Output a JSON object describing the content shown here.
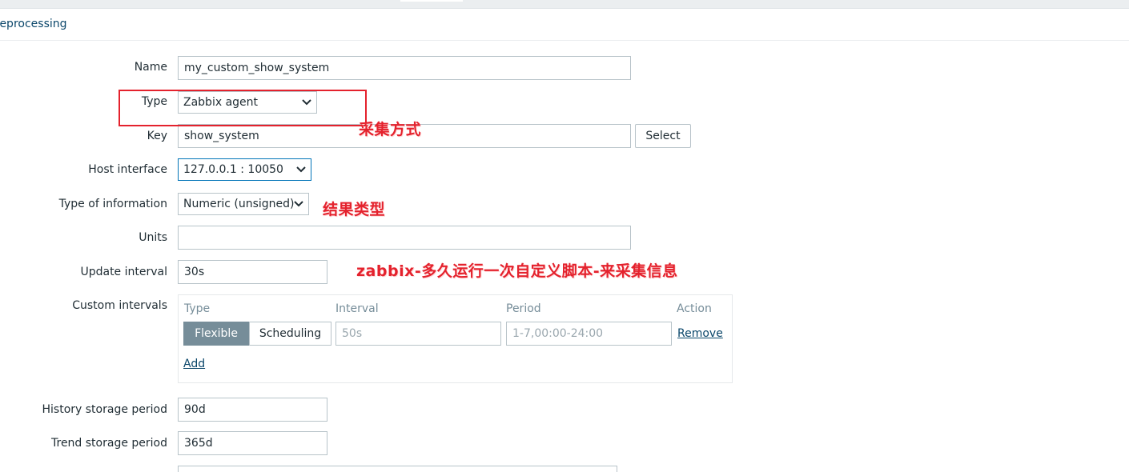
{
  "tabs": {
    "preprocessing": "reprocessing"
  },
  "form": {
    "name": {
      "label": "Name",
      "value": "my_custom_show_system"
    },
    "type": {
      "label": "Type",
      "value": "Zabbix agent"
    },
    "key": {
      "label": "Key",
      "value": "show_system",
      "select_button": "Select"
    },
    "host_interface": {
      "label": "Host interface",
      "value": "127.0.0.1 : 10050"
    },
    "type_of_information": {
      "label": "Type of information",
      "value": "Numeric (unsigned)"
    },
    "units": {
      "label": "Units",
      "value": ""
    },
    "update_interval": {
      "label": "Update interval",
      "value": "30s"
    },
    "custom_intervals": {
      "label": "Custom intervals",
      "columns": [
        "Type",
        "Interval",
        "Period",
        "Action"
      ],
      "row": {
        "type_options": [
          "Flexible",
          "Scheduling"
        ],
        "selected_type": "Flexible",
        "interval_placeholder": "50s",
        "period_placeholder": "1-7,00:00-24:00",
        "remove": "Remove"
      },
      "add": "Add"
    },
    "history_storage_period": {
      "label": "History storage period",
      "value": "90d"
    },
    "trend_storage_period": {
      "label": "Trend storage period",
      "value": "365d"
    }
  },
  "annotations": {
    "type_note": "采集方式",
    "info_note": "结果类型",
    "interval_note": "zabbix-多久运行一次自定义脚本-来采集信息"
  },
  "colors": {
    "annotation": "#e4222d",
    "link": "#0a466a",
    "active_segment": "#768d99"
  }
}
